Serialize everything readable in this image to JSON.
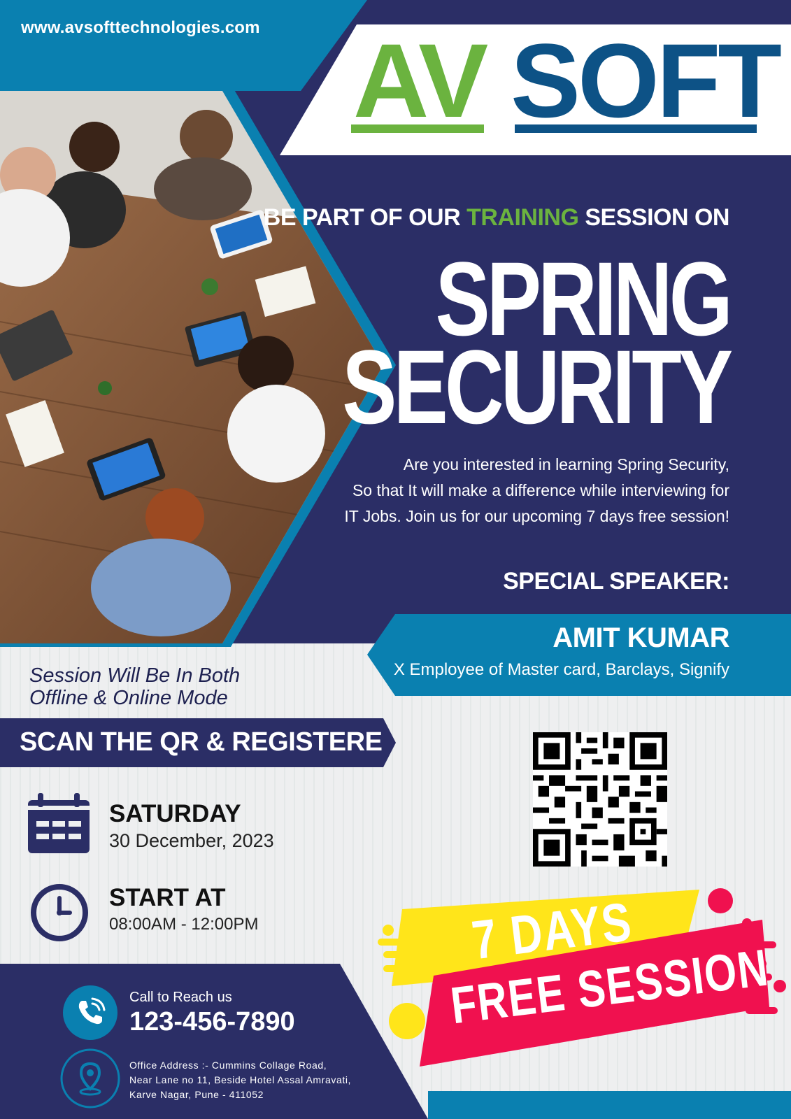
{
  "header": {
    "website": "www.avsofttechnologies.com",
    "logo_left": "AV",
    "logo_right": "SOFT"
  },
  "headline": {
    "prefix": "BE PART OF OUR ",
    "highlight": "TRAINING",
    "suffix": " SESSION ON"
  },
  "course": {
    "line1": "SPRING",
    "line2": "SECURITY"
  },
  "description": {
    "lines": [
      "Are you interested in learning Spring Security,",
      "So that It will make a difference while interviewing for",
      "IT Jobs. Join us for our upcoming 7 days free session!"
    ]
  },
  "speaker": {
    "label": "SPECIAL SPEAKER:",
    "name": "AMIT KUMAR",
    "role": "X Employee of  Master card, Barclays, Signify"
  },
  "mode": {
    "line1": "Session Will Be In Both",
    "line2": "Offline & Online Mode"
  },
  "register": {
    "label": "SCAN THE QR & REGISTERE"
  },
  "schedule": {
    "day": "SATURDAY",
    "date": "30 December, 2023",
    "start_label": "START AT",
    "time": "08:00AM - 12:00PM"
  },
  "offer": {
    "line1": "7 DAYS",
    "line2": "FREE SESSION"
  },
  "contact": {
    "call_label": "Call to Reach us",
    "phone": "123-456-7890",
    "address_lines": [
      "Office Address :- Cummins Collage Road,",
      "Near Lane no 11, Beside Hotel Assal Amravati,",
      "Karve Nagar, Pune - 411052"
    ]
  },
  "colors": {
    "navy": "#2b2e66",
    "blue": "#0a80b0",
    "green": "#6bb33f",
    "logo_blue": "#0d5286",
    "yellow": "#ffe51a",
    "pink": "#f0114f",
    "light": "#eeeff0"
  },
  "icons": [
    "calendar-icon",
    "clock-icon",
    "phone-icon",
    "location-pin-icon",
    "qr-code"
  ]
}
